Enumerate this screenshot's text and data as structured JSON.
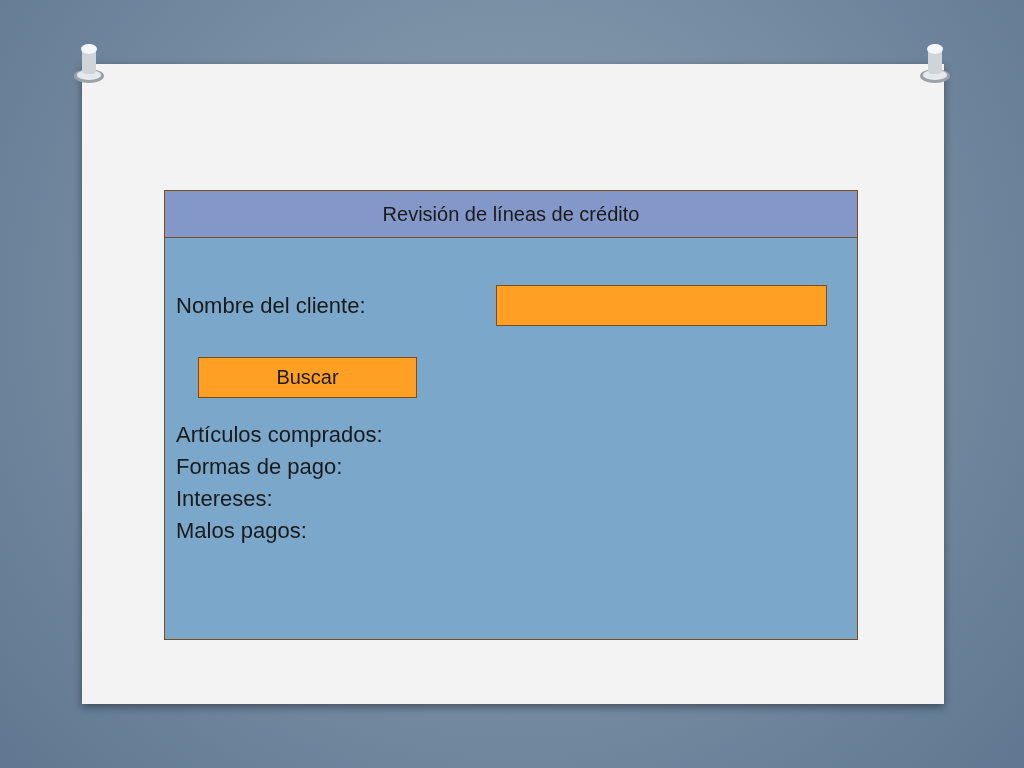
{
  "form": {
    "title": "Revisión de líneas de crédito",
    "client_label": "Nombre del cliente:",
    "search_button": "Buscar",
    "result_labels": [
      "Artículos comprados:",
      "Formas de pago:",
      "Intereses:",
      "Malos pagos:"
    ]
  }
}
